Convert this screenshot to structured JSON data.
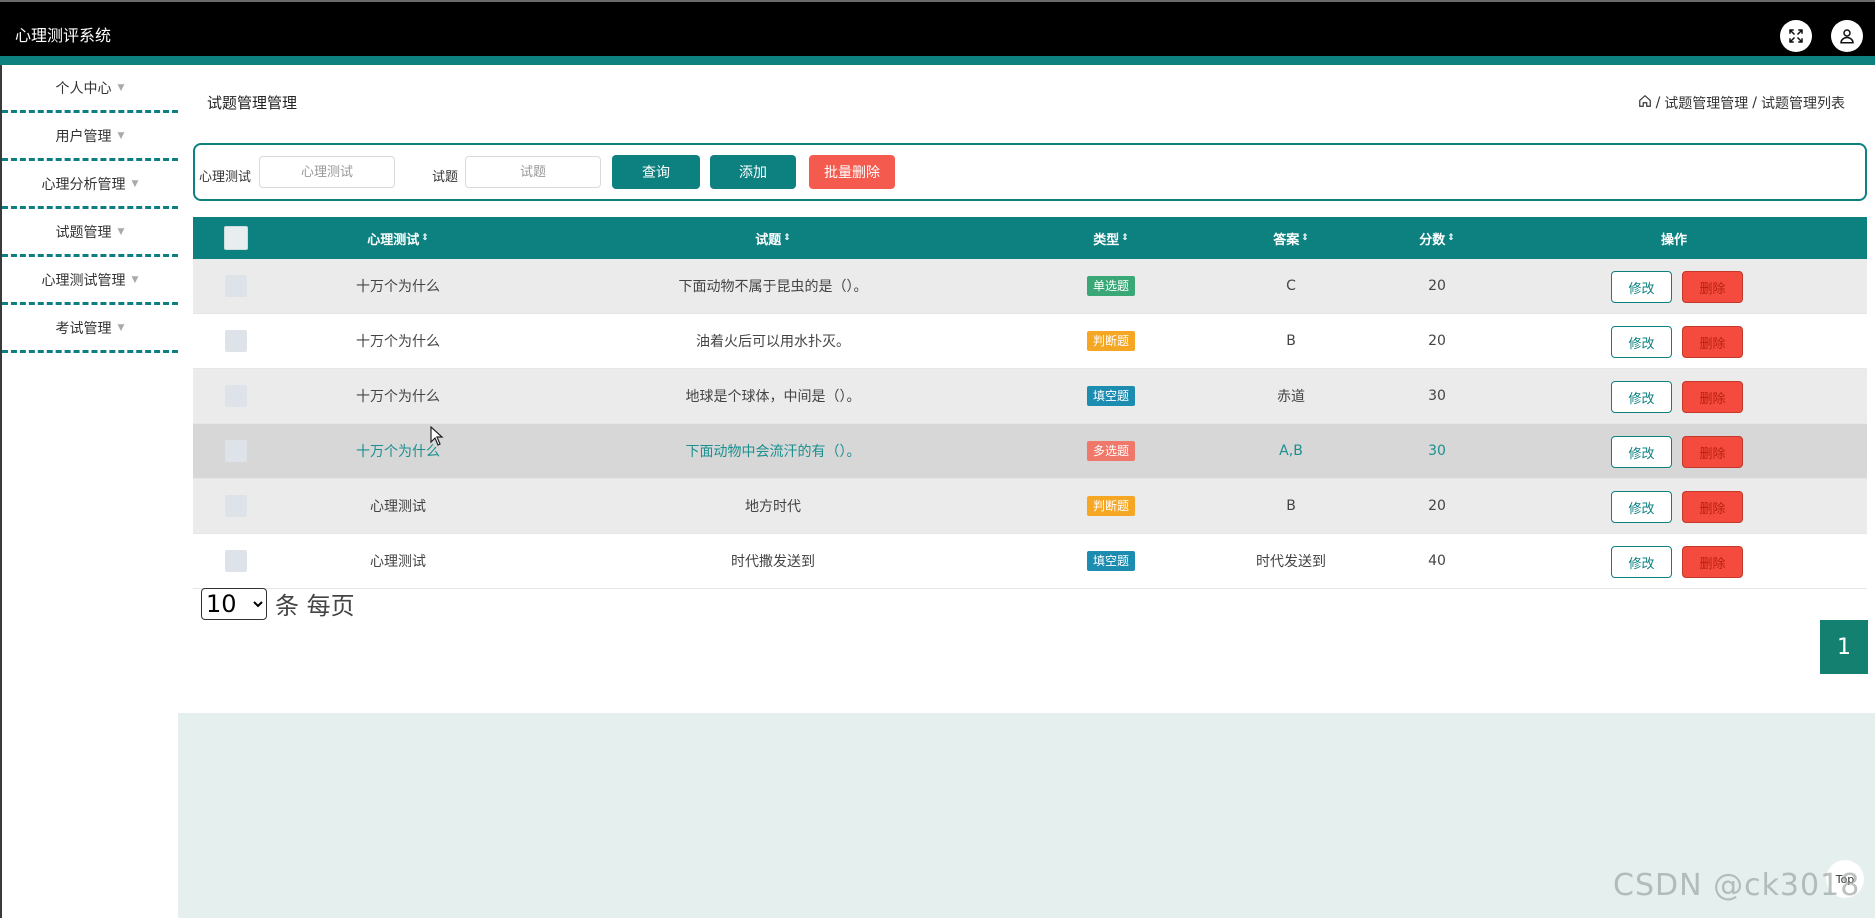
{
  "app": {
    "title": "心理测评系统"
  },
  "header": {
    "icons": [
      "fullscreen-icon",
      "user-icon"
    ]
  },
  "sidebar": {
    "items": [
      {
        "label": "个人中心"
      },
      {
        "label": "用户管理"
      },
      {
        "label": "心理分析管理"
      },
      {
        "label": "试题管理"
      },
      {
        "label": "心理测试管理"
      },
      {
        "label": "考试管理"
      }
    ]
  },
  "page": {
    "title": "试题管理管理",
    "breadcrumb": [
      "试题管理管理",
      "试题管理列表"
    ]
  },
  "search": {
    "test_label": "心理测试",
    "test_placeholder": "心理测试",
    "question_label": "试题",
    "question_placeholder": "试题",
    "query_button": "查询",
    "add_button": "添加",
    "batch_delete_button": "批量删除"
  },
  "table": {
    "columns": {
      "test": "心理测试",
      "question": "试题",
      "type": "类型",
      "answer": "答案",
      "score": "分数",
      "actions": "操作"
    },
    "rows": [
      {
        "test": "十万个为什么",
        "question": "下面动物不属于昆虫的是（）。",
        "type": "单选题",
        "type_color": "#3aa876",
        "answer": "C",
        "score": "20"
      },
      {
        "test": "十万个为什么",
        "question": "油着火后可以用水扑灭。",
        "type": "判断题",
        "type_color": "#f5a623",
        "answer": "B",
        "score": "20"
      },
      {
        "test": "十万个为什么",
        "question": "地球是个球体，中间是（）。",
        "type": "填空题",
        "type_color": "#1c8cb0",
        "answer": "赤道",
        "score": "30"
      },
      {
        "test": "十万个为什么",
        "question": "下面动物中会流汗的有（）。",
        "type": "多选题",
        "type_color": "#f0786a",
        "answer": "A,B",
        "score": "30"
      },
      {
        "test": "心理测试",
        "question": "地方时代",
        "type": "判断题",
        "type_color": "#f5a623",
        "answer": "B",
        "score": "20"
      },
      {
        "test": "心理测试",
        "question": "时代撒发送到",
        "type": "填空题",
        "type_color": "#1c8cb0",
        "answer": "时代发送到",
        "score": "40"
      }
    ],
    "edit_label": "修改",
    "delete_label": "删除"
  },
  "pagination": {
    "page_size": "10",
    "page_size_options": [
      "10"
    ],
    "page_size_suffix": "条 每页",
    "current_page": "1"
  },
  "back_to_top": "Top",
  "watermark": "CSDN @ck3018",
  "colors": {
    "accent": "#0d8080",
    "danger": "#f44b3e",
    "header": "#000000"
  }
}
